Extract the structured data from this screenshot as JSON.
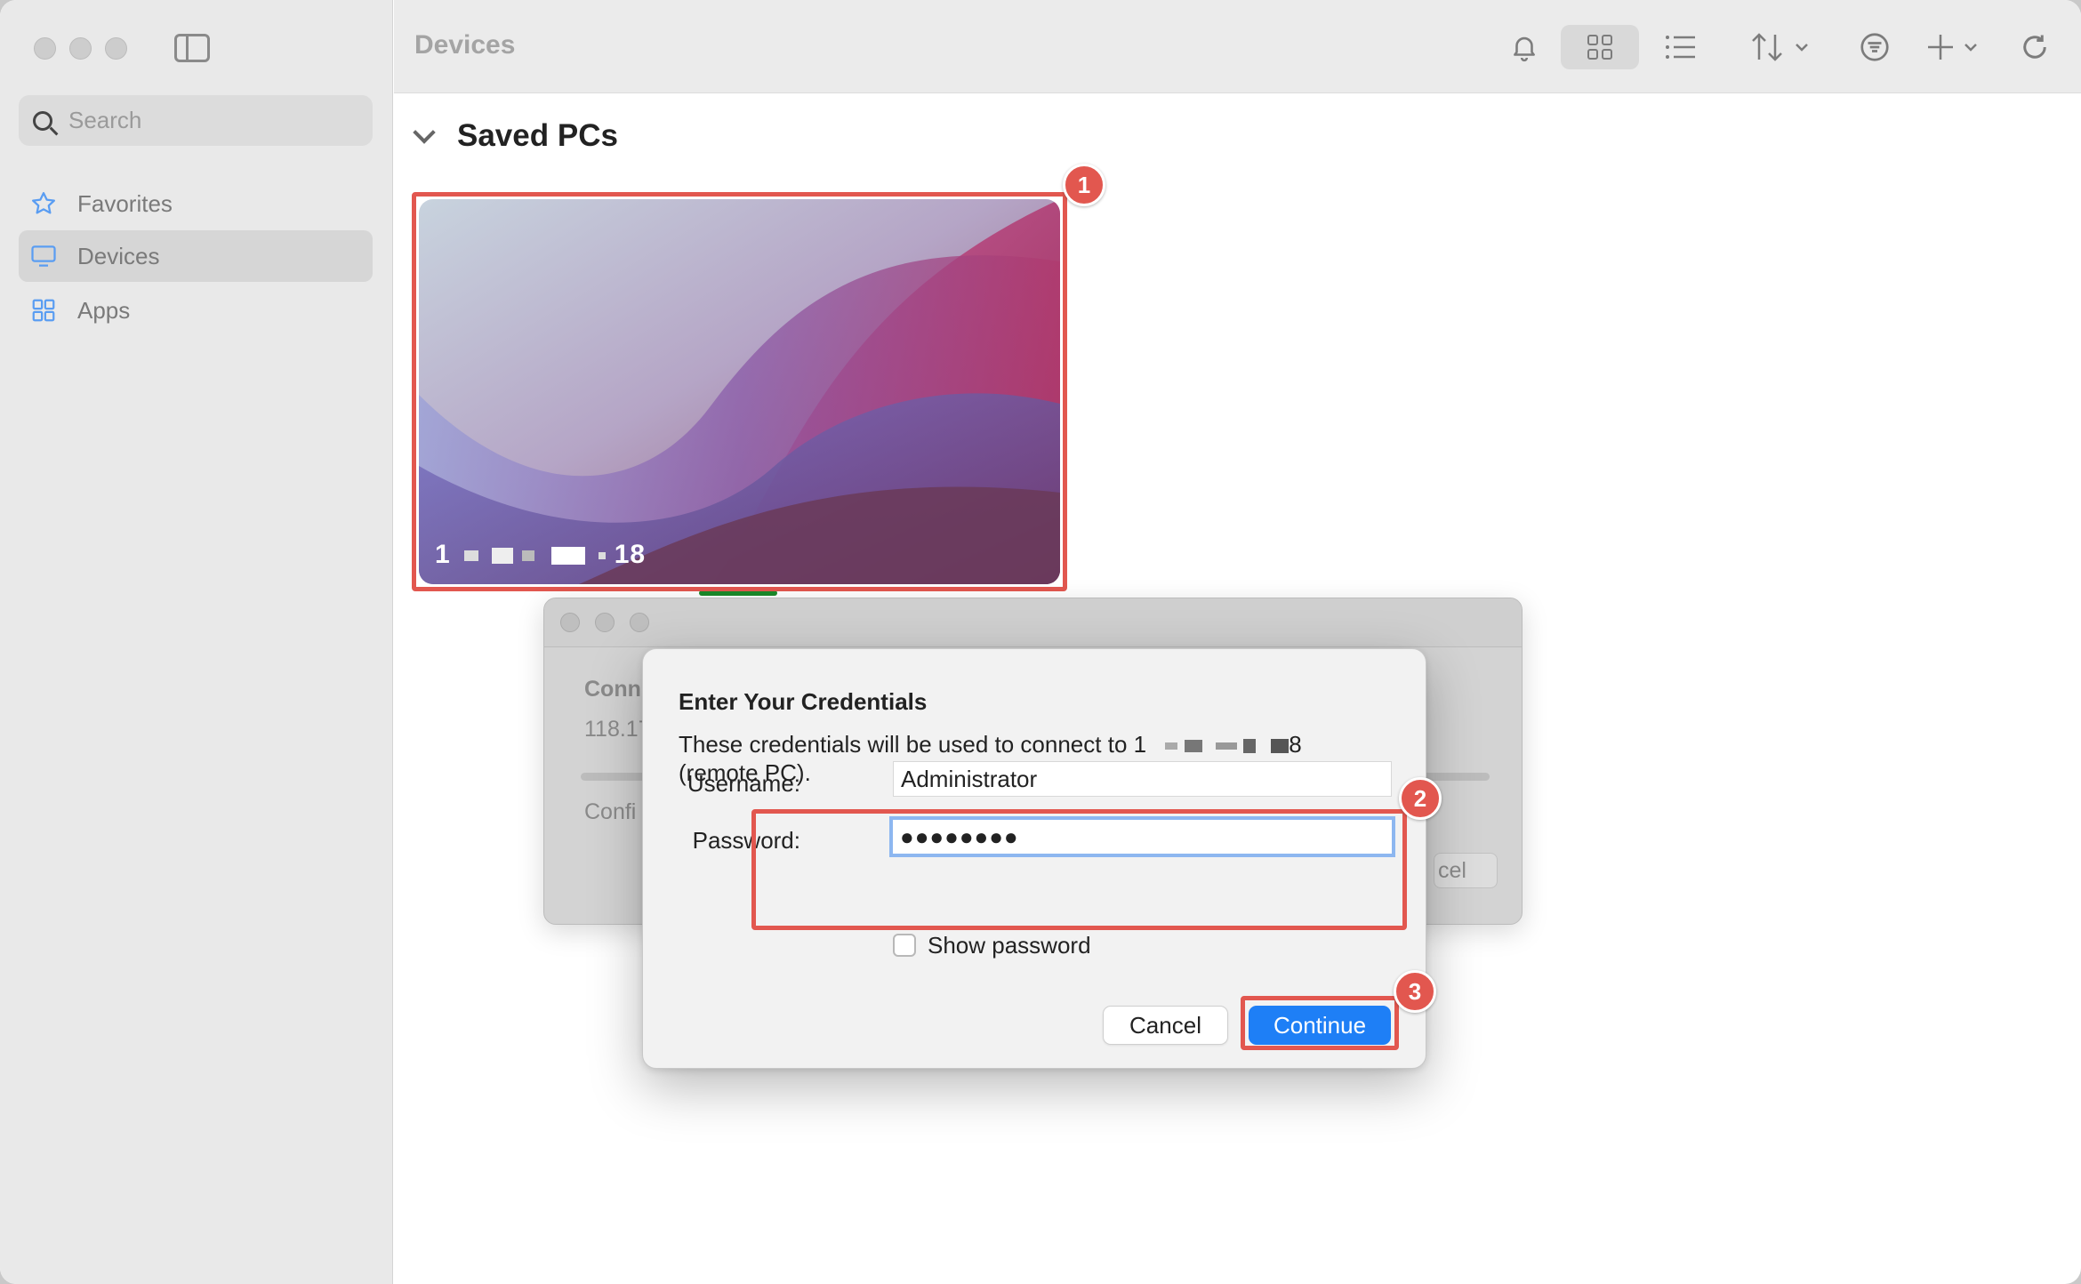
{
  "sidebar": {
    "search_placeholder": "Search",
    "items": [
      {
        "label": "Favorites",
        "icon": "star-icon"
      },
      {
        "label": "Devices",
        "icon": "monitor-icon",
        "active": true
      },
      {
        "label": "Apps",
        "icon": "apps-icon"
      }
    ]
  },
  "toolbar": {
    "title": "Devices",
    "icons": [
      "bell-icon",
      "grid-view-icon",
      "list-view-icon",
      "sort-icon",
      "filter-icon",
      "add-icon",
      "refresh-icon"
    ]
  },
  "content": {
    "section_title": "Saved PCs",
    "pc": {
      "name_start": "1",
      "name_end": "18"
    }
  },
  "connecting_window": {
    "title_partial": "Conn",
    "address_partial": "118.17",
    "status_partial": "Confi",
    "cancel_partial": "cel"
  },
  "dialog": {
    "title": "Enter Your Credentials",
    "message_prefix": "These credentials will be used to connect to 1",
    "message_suffix": "8",
    "message_line2": "(remote PC).",
    "username_label": "Username:",
    "username_value": "Administrator",
    "password_label": "Password:",
    "password_value": "●●●●●●●●",
    "show_password_label": "Show password",
    "cancel_label": "Cancel",
    "continue_label": "Continue"
  },
  "annotations": [
    "1",
    "2",
    "3"
  ],
  "colors": {
    "accent": "#1e7ff6",
    "highlight": "#e2574f",
    "sidebar_bg": "#e9e9e9",
    "status_green": "#1a8a2a"
  }
}
